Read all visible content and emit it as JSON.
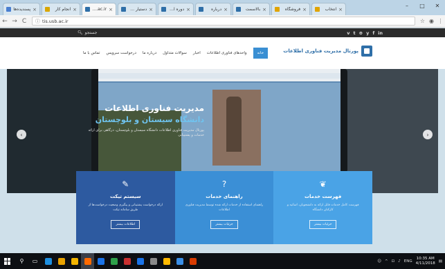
{
  "browser": {
    "tabs": [
      {
        "label": "پسندیده‌ها",
        "color": "#4a7fd0"
      },
      {
        "label": "انجام کار",
        "color": "#d9a600"
      },
      {
        "label": "tis.ac.ir",
        "color": "#2f6fa8",
        "active": true
      },
      {
        "label": "دستیار شما",
        "color": "#2f6fa8"
      },
      {
        "label": "دوره آموزشی",
        "color": "#2f6fa8"
      },
      {
        "label": "درباره",
        "color": "#2f6fa8"
      },
      {
        "label": "بالاسمت",
        "color": "#2f6fa8"
      },
      {
        "label": "فروشگاه",
        "color": "#e0a400"
      },
      {
        "label": "انتخاب",
        "color": "#e0a400"
      }
    ],
    "url": "tis.usb.ac.ir",
    "window_controls": [
      "–",
      "□",
      "✕"
    ]
  },
  "site": {
    "social": [
      "v",
      "t",
      "⊕",
      "y",
      "f",
      "in"
    ],
    "search_label": "جستجو",
    "logo_text": "پورتال مدیریت فناوری اطلاعات",
    "menu": [
      "خانه",
      "واحدهای فناوری اطلاعات",
      "اخبار",
      "سوالات متداول",
      "درباره ما",
      "درخواست سرویس",
      "تماس با ما"
    ]
  },
  "hero": {
    "title": "مدیریت فناوری اطلاعات",
    "subtitle": "دانشگاه سیستان و بلوچستان",
    "description": "پورتال مدیریت فناوری اطلاعات دانشگاه سیستان و بلوچستان، درگاهی برای ارائه خدمات و پشتیبانی"
  },
  "cards": [
    {
      "icon": "✎",
      "title": "سیستم تیکت",
      "desc": "ارائه درخواست پشتیبانی و پیگیری وضعیت درخواست‌ها از طریق سامانه تیکت",
      "button": "اطلاعات بیشتر"
    },
    {
      "icon": "?",
      "title": "راهنمای خدمات",
      "desc": "راهنمای استفاده از خدمات ارائه شده توسط مدیریت فناوری اطلاعات",
      "button": "جزئیات بیشتر"
    },
    {
      "icon": "❦",
      "title": "فهرست خدمات",
      "desc": "فهرست کامل خدمات قابل ارائه به دانشجویان، اساتید و کارکنان دانشگاه",
      "button": "جزئیات بیشتر"
    }
  ],
  "taskbar": {
    "apps": [
      "#1e8fe0",
      "#e8a200",
      "#f2b400",
      "#ff6a00",
      "#1a73e8",
      "#2ea04a",
      "#c93030",
      "#1a73e8",
      "#8a8a8a",
      "#ffb900",
      "#3a8ee6",
      "#d83b01"
    ],
    "tray_lang": "ENG",
    "time": "10:35 AM",
    "date": "4/11/2018"
  }
}
